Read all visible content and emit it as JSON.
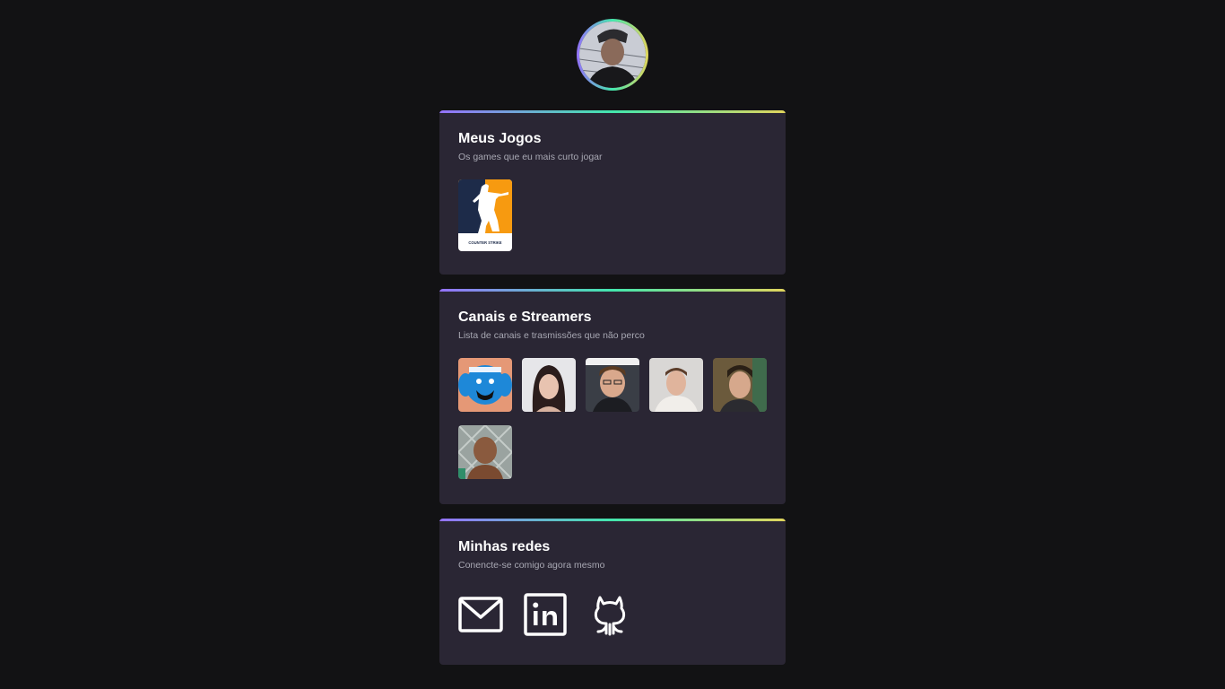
{
  "profile": {
    "avatar_icon": "profile-photo"
  },
  "games_card": {
    "title": "Meus Jogos",
    "subtitle": "Os games que eu mais curto jogar",
    "games": [
      {
        "icon": "counter-strike-logo",
        "logo_text": "COUNTER STRIKE"
      }
    ]
  },
  "streamers_card": {
    "title": "Canais e Streamers",
    "subtitle": "Lista de canais e trasmissões que não perco",
    "streamers": [
      {
        "icon": "streamer-avatar-1"
      },
      {
        "icon": "streamer-avatar-2"
      },
      {
        "icon": "streamer-avatar-3"
      },
      {
        "icon": "streamer-avatar-4"
      },
      {
        "icon": "streamer-avatar-5"
      },
      {
        "icon": "streamer-avatar-6"
      }
    ]
  },
  "social_card": {
    "title": "Minhas redes",
    "subtitle": "Conencte-se comigo agora mesmo",
    "links": [
      {
        "icon": "mail-icon"
      },
      {
        "icon": "linkedin-icon"
      },
      {
        "icon": "github-icon"
      }
    ]
  },
  "colors": {
    "background": "#121214",
    "card": "#2a2634",
    "gradient": [
      "#9572fc",
      "#43e7ad",
      "#e1d55d"
    ],
    "subtitle_text": "#a8a8b3"
  }
}
